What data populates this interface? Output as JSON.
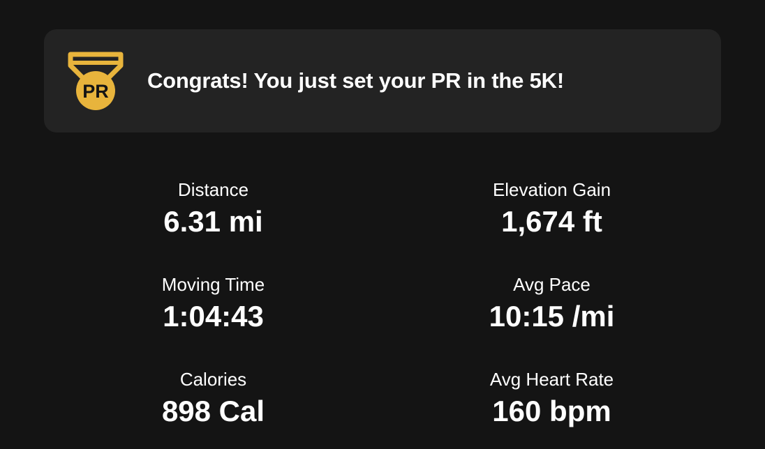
{
  "banner": {
    "icon": "pr-medal-icon",
    "badge_text": "PR",
    "message": "Congrats! You just set your PR in the 5K!",
    "accent_color": "#E8B43C"
  },
  "stats": [
    {
      "label": "Distance",
      "value": "6.31 mi"
    },
    {
      "label": "Elevation Gain",
      "value": "1,674 ft"
    },
    {
      "label": "Moving Time",
      "value": "1:04:43"
    },
    {
      "label": "Avg Pace",
      "value": "10:15 /mi"
    },
    {
      "label": "Calories",
      "value": "898 Cal"
    },
    {
      "label": "Avg Heart Rate",
      "value": "160 bpm"
    }
  ]
}
